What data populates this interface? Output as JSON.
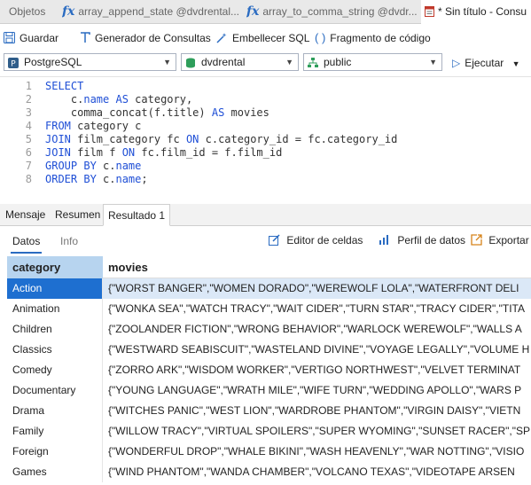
{
  "tabs": [
    {
      "label": "Objetos",
      "icon": ""
    },
    {
      "label": "array_append_state @dvdrental...",
      "icon": "fx"
    },
    {
      "label": "array_to_comma_string @dvdr...",
      "icon": "fx"
    },
    {
      "label": "* Sin título - Consu",
      "icon": "query"
    }
  ],
  "toolbar": {
    "save": "Guardar",
    "query_builder": "Generador de Consultas",
    "beautify": "Embellecer SQL",
    "snippet": "Fragmento de código"
  },
  "selectors": {
    "connection": "PostgreSQL",
    "database": "dvdrental",
    "schema": "public",
    "run": "Ejecutar"
  },
  "editor": {
    "line_numbers": [
      "1",
      "2",
      "3",
      "4",
      "5",
      "6",
      "7",
      "8"
    ],
    "lines": [
      [
        {
          "t": "SELECT",
          "k": true
        }
      ],
      [
        {
          "t": "    c.",
          "k": false
        },
        {
          "t": "name",
          "k": true
        },
        {
          "t": " ",
          "k": false
        },
        {
          "t": "AS",
          "k": true
        },
        {
          "t": " category,",
          "k": false
        }
      ],
      [
        {
          "t": "    comma_concat(f.title) ",
          "k": false
        },
        {
          "t": "AS",
          "k": true
        },
        {
          "t": " movies",
          "k": false
        }
      ],
      [
        {
          "t": "FROM",
          "k": true
        },
        {
          "t": " category c",
          "k": false
        }
      ],
      [
        {
          "t": "JOIN",
          "k": true
        },
        {
          "t": " film_category fc ",
          "k": false
        },
        {
          "t": "ON",
          "k": true
        },
        {
          "t": " c.category_id = fc.category_id",
          "k": false
        }
      ],
      [
        {
          "t": "JOIN",
          "k": true
        },
        {
          "t": " film f ",
          "k": false
        },
        {
          "t": "ON",
          "k": true
        },
        {
          "t": " fc.film_id = f.film_id",
          "k": false
        }
      ],
      [
        {
          "t": "GROUP BY",
          "k": true
        },
        {
          "t": " c.",
          "k": false
        },
        {
          "t": "name",
          "k": true
        }
      ],
      [
        {
          "t": "ORDER BY",
          "k": true
        },
        {
          "t": " c.",
          "k": false
        },
        {
          "t": "name",
          "k": true
        },
        {
          "t": ";",
          "k": false
        }
      ]
    ]
  },
  "result_tabs": [
    "Mensaje",
    "Resumen",
    "Resultado 1"
  ],
  "sub": {
    "data_tab": "Datos",
    "info_tab": "Info",
    "cell_editor": "Editor de celdas",
    "data_profile": "Perfil de datos",
    "export": "Exportar"
  },
  "grid": {
    "columns": [
      "category",
      "movies"
    ],
    "rows": [
      [
        "Action",
        "{\"WORST BANGER\",\"WOMEN DORADO\",\"WEREWOLF LOLA\",\"WATERFRONT DELI"
      ],
      [
        "Animation",
        "{\"WONKA SEA\",\"WATCH TRACY\",\"WAIT CIDER\",\"TURN STAR\",\"TRACY CIDER\",\"TITA"
      ],
      [
        "Children",
        "{\"ZOOLANDER FICTION\",\"WRONG BEHAVIOR\",\"WARLOCK WEREWOLF\",\"WALLS A"
      ],
      [
        "Classics",
        "{\"WESTWARD SEABISCUIT\",\"WASTELAND DIVINE\",\"VOYAGE LEGALLY\",\"VOLUME H"
      ],
      [
        "Comedy",
        "{\"ZORRO ARK\",\"WISDOM WORKER\",\"VERTIGO NORTHWEST\",\"VELVET TERMINAT"
      ],
      [
        "Documentary",
        "{\"YOUNG LANGUAGE\",\"WRATH MILE\",\"WIFE TURN\",\"WEDDING APOLLO\",\"WARS P"
      ],
      [
        "Drama",
        "{\"WITCHES PANIC\",\"WEST LION\",\"WARDROBE PHANTOM\",\"VIRGIN DAISY\",\"VIETN"
      ],
      [
        "Family",
        "{\"WILLOW TRACY\",\"VIRTUAL SPOILERS\",\"SUPER WYOMING\",\"SUNSET RACER\",\"SP"
      ],
      [
        "Foreign",
        "{\"WONDERFUL DROP\",\"WHALE BIKINI\",\"WASH HEAVENLY\",\"WAR NOTTING\",\"VISIO"
      ],
      [
        "Games",
        "{\"WIND PHANTOM\",\"WANDA CHAMBER\",\"VOLCANO TEXAS\",\"VIDEOTAPE ARSEN"
      ]
    ]
  }
}
